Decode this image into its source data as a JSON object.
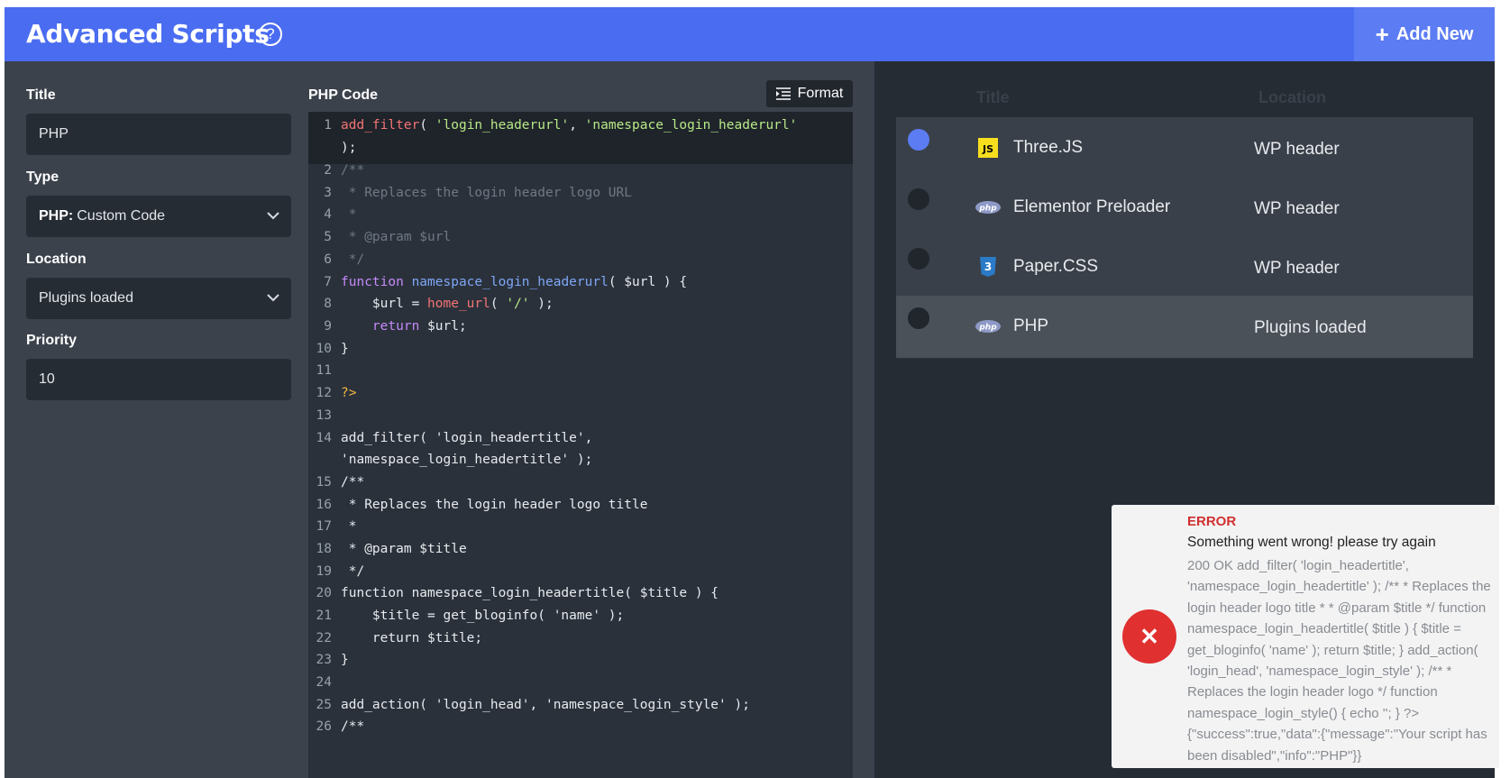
{
  "header": {
    "title": "Advanced Scripts",
    "help_icon": "question-circle-icon",
    "add_new_label": "Add New"
  },
  "form": {
    "title_label": "Title",
    "title_value": "PHP",
    "type_label": "Type",
    "type_value_bold": "PHP:",
    "type_value": "Custom Code",
    "location_label": "Location",
    "location_value": "Plugins loaded",
    "priority_label": "Priority",
    "priority_value": "10"
  },
  "editor": {
    "label": "PHP Code",
    "format_label": "Format",
    "line_numbers": [
      "1",
      "2",
      "3",
      "4",
      "5",
      "6",
      "7",
      "8",
      "9",
      "10",
      "11",
      "12",
      "13",
      "14",
      "15",
      "16",
      "17",
      "18",
      "19",
      "20",
      "21",
      "22",
      "23",
      "24",
      "25",
      "26"
    ]
  },
  "list": {
    "col_title": "Title",
    "col_location": "Location",
    "rows": [
      {
        "title": "Three.JS",
        "location": "WP header",
        "icon": "js-icon",
        "enabled": true
      },
      {
        "title": "Elementor Preloader",
        "location": "WP header",
        "icon": "php-icon",
        "enabled": false
      },
      {
        "title": "Paper.CSS",
        "location": "WP header",
        "icon": "css3-icon",
        "enabled": false
      },
      {
        "title": "PHP",
        "location": "Plugins loaded",
        "icon": "php-icon",
        "enabled": false
      }
    ]
  },
  "toast": {
    "title": "ERROR",
    "message": "Something went wrong! please try again",
    "detail": "200 OK add_filter( 'login_headertitle', 'namespace_login_headertitle' ); /** * Replaces the login header logo title * * @param $title */ function namespace_login_headertitle( $title ) { $title = get_bloginfo( 'name' ); return $title; } add_action( 'login_head', 'namespace_login_style' ); /** * Replaces the login header logo */ function namespace_login_style() { echo ''; } ?>{\"success\":true,\"data\":{\"message\":\"Your script has been disabled\",\"info\":\"PHP\"}}",
    "icon": "close-icon"
  },
  "colors": {
    "accent": "#4a6cf0",
    "error": "#e03030"
  }
}
